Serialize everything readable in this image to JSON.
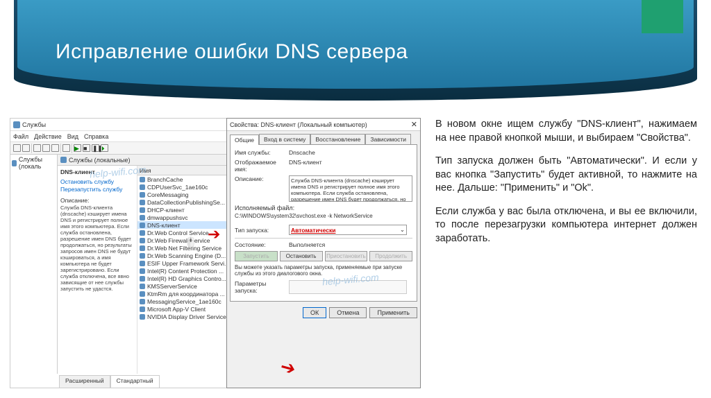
{
  "slide": {
    "title": "Исправление ошибки DNS сервера"
  },
  "instructions": {
    "p1": "В новом окне ищем службу \"DNS-клиент\", нажимаем на нее правой кнопкой мыши, и выбираем \"Свойства\".",
    "p2": "Тип запуска должен быть \"Автоматически\". И если у вас кнопка \"Запустить\" будет активной, то нажмите на нее. Дальше: \"Применить\" и \"Ok\".",
    "p3": "Если служба у вас была отключена, и вы ее включили, то после перезагрузки компьютера интернет должен заработать."
  },
  "servicesWindow": {
    "title": "Службы",
    "menu": [
      "Файл",
      "Действие",
      "Вид",
      "Справка"
    ],
    "navItem": "Службы (локаль",
    "panelHead": "Службы (локальные)",
    "detail": {
      "name": "DNS-клиент",
      "stop": "Остановить службу",
      "restart": "Перезапустить службу",
      "descLabel": "Описание:",
      "desc": "Служба DNS-клиента (dnscache) кэширует имена DNS и регистрирует полное имя этого компьютера. Если служба остановлена, разрешение имен DNS будет продолжаться, но результаты запросов имен DNS не будут кэшироваться, а имя компьютера не будет зарегистрировано. Если служба отключена, все явно зависящие от нее службы запустить не удастся."
    },
    "listHead": "Имя",
    "items": [
      "BranchCache",
      "CDPUserSvc_1ae160c",
      "CoreMessaging",
      "DataCollectionPublishingSe...",
      "DHCP-клиент",
      "dmwappushsvc",
      "DNS-клиент",
      "Dr.Web Control Service",
      "Dr.Web Firewall Service",
      "Dr.Web Net Filtering Service",
      "Dr.Web Scanning Engine (D...",
      "ESIF Upper Framework Servi...",
      "Intel(R) Content Protection ...",
      "Intel(R) HD Graphics Contro...",
      "KMSServerService",
      "KtmRm для координатора ...",
      "MessagingService_1ae160c",
      "Microsoft App-V Client",
      "NVIDIA Display Driver Service"
    ],
    "tabs": [
      "Расширенный",
      "Стандартный"
    ]
  },
  "propsDialog": {
    "title": "Свойства: DNS-клиент (Локальный компьютер)",
    "tabs": [
      "Общие",
      "Вход в систему",
      "Восстановление",
      "Зависимости"
    ],
    "fields": {
      "nameLabel": "Имя службы:",
      "nameValue": "Dnscache",
      "dispLabel": "Отображаемое имя:",
      "dispValue": "DNS-клиент",
      "descLabel": "Описание:",
      "descValue": "Служба DNS-клиента (dnscache) кэширует имена DNS и регистрирует полное имя этого компьютера. Если служба остановлена, разрешение имен DNS будет продолжаться, но",
      "execLabel": "Исполняемый файл:",
      "execValue": "C:\\WINDOWS\\system32\\svchost.exe -k NetworkService",
      "startLabel": "Тип запуска:",
      "startValue": "Автоматически",
      "stateLabel": "Состояние:",
      "stateValue": "Выполняется"
    },
    "buttons": {
      "start": "Запустить",
      "stop": "Остановить",
      "pause": "Приостановить",
      "resume": "Продолжить"
    },
    "note": "Вы можете указать параметры запуска, применяемые при запуске службы из этого диалогового окна.",
    "paramLabel": "Параметры запуска:",
    "footer": {
      "ok": "ОК",
      "cancel": "Отмена",
      "apply": "Применить"
    }
  },
  "watermark": "help-wifi.com"
}
